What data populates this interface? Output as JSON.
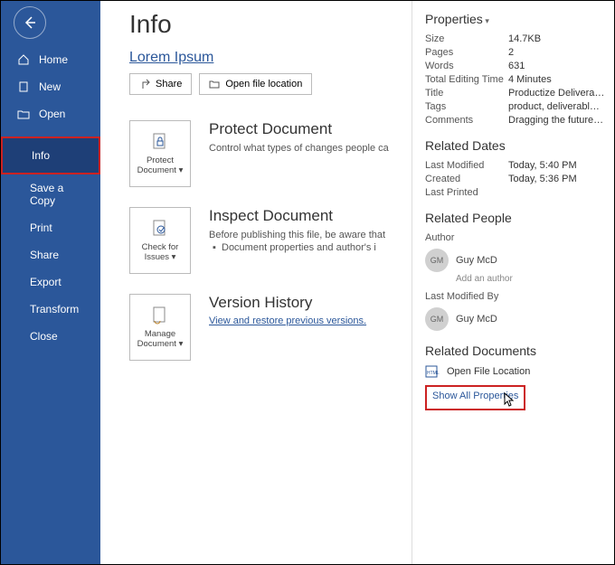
{
  "sidebar": {
    "home": "Home",
    "new": "New",
    "open": "Open",
    "info": "Info",
    "save_copy": "Save a Copy",
    "print": "Print",
    "share": "Share",
    "export": "Export",
    "transform": "Transform",
    "close": "Close"
  },
  "main": {
    "title": "Info",
    "doc_name": "Lorem Ipsum",
    "share_btn": "Share",
    "open_loc_btn": "Open file location",
    "protect": {
      "tile_l1": "Protect",
      "tile_l2": "Document ▾",
      "title": "Protect Document",
      "desc": "Control what types of changes people ca"
    },
    "inspect": {
      "tile_l1": "Check for",
      "tile_l2": "Issues ▾",
      "title": "Inspect Document",
      "desc": "Before publishing this file, be aware that",
      "bullet": "Document properties and author's i"
    },
    "version": {
      "tile_l1": "Manage",
      "tile_l2": "Document ▾",
      "title": "Version History",
      "link": "View and restore previous versions."
    }
  },
  "props": {
    "heading": "Properties",
    "rows": {
      "size_l": "Size",
      "size_v": "14.7KB",
      "pages_l": "Pages",
      "pages_v": "2",
      "words_l": "Words",
      "words_v": "631",
      "edit_l": "Total Editing Time",
      "edit_v": "4 Minutes",
      "title_l": "Title",
      "title_v": "Productize Deliverables",
      "tags_l": "Tags",
      "tags_v": "product, deliverables, opti...",
      "comments_l": "Comments",
      "comments_v": "Dragging the future into n..."
    },
    "dates_h": "Related Dates",
    "dates": {
      "mod_l": "Last Modified",
      "mod_v": "Today, 5:40 PM",
      "cre_l": "Created",
      "cre_v": "Today, 5:36 PM",
      "prn_l": "Last Printed",
      "prn_v": ""
    },
    "people_h": "Related People",
    "author_l": "Author",
    "author_initials": "GM",
    "author_name": "Guy McD",
    "add_author": "Add an author",
    "modby_l": "Last Modified By",
    "modby_initials": "GM",
    "modby_name": "Guy McD",
    "docs_h": "Related Documents",
    "open_file_loc": "Open File Location",
    "show_all": "Show All Properties"
  }
}
